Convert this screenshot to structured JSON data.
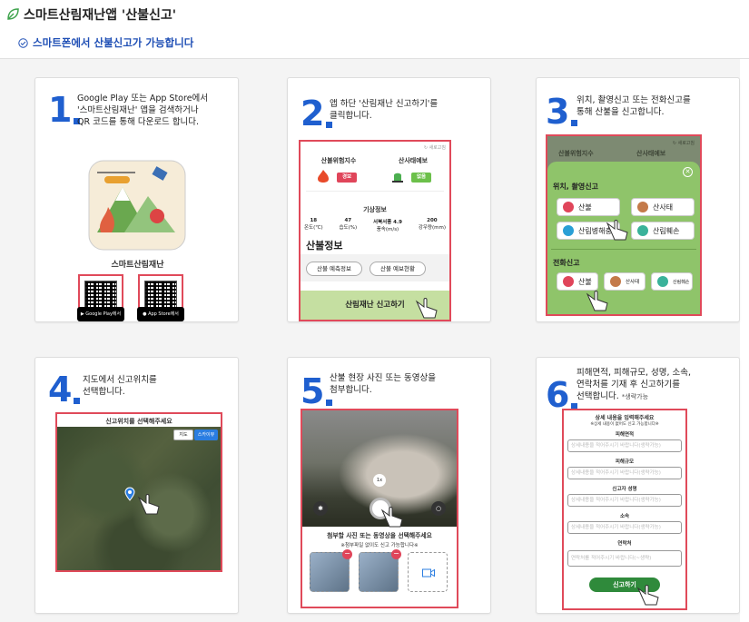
{
  "header": {
    "title": "스마트산림재난앱 '산불신고'",
    "subtitle": "스마트폰에서 산불신고가 가능합니다"
  },
  "colors": {
    "accent": "#1f5fcf",
    "highlight": "#e04a5a",
    "subtitle": "#1f4fb5",
    "panel": "#f4f4f4"
  },
  "steps": [
    {
      "num": "1",
      "lines": [
        "Google Play 또는 App Store에서",
        "'스마트산림재난' 앱을 검색하거나",
        "QR 코드를 통해 다운로드 합니다."
      ],
      "app_name": "스마트산림재난",
      "google_play": "Google Play에서",
      "app_store": "App Store에서"
    },
    {
      "num": "2",
      "lines": [
        "앱 하단 '산림재난 신고하기'를",
        "클릭합니다."
      ],
      "refresh": "새로고침",
      "fire_risk": "산불위험지수",
      "landslide": "산사태예보",
      "fire_level": "경보",
      "slide_level": "없음",
      "weather_title": "기상정보",
      "weather": [
        {
          "v": "18",
          "l": "온도(℃)"
        },
        {
          "v": "47",
          "l": "습도(%)"
        },
        {
          "v": "서북서풍 4.9",
          "l": "풍속(m/s)"
        },
        {
          "v": "200",
          "l": "강우량(mm)"
        }
      ],
      "info_title": "산불정보",
      "btn1": "산불 예측정보",
      "btn2": "산불 예보현황",
      "report_btn": "산림재난 신고하기"
    },
    {
      "num": "3",
      "lines": [
        "위치, 촬영신고 또는 전화신고를",
        "통해 산불을 신고합니다."
      ],
      "refresh": "새로고침",
      "bg1": "산불위험지수",
      "bg2": "산사태예보",
      "sec1": "위치, 촬영신고",
      "opt": [
        "산불",
        "산사태",
        "산림병해충",
        "산림훼손"
      ],
      "sec2": "전화신고",
      "call": [
        "산불",
        "산사태",
        "산림훼손"
      ]
    },
    {
      "num": "4",
      "lines": [
        "지도에서 신고위치를",
        "선택합니다."
      ],
      "map_title": "신고위치를 선택해주세요",
      "map_btn1": "지도",
      "map_btn2": "스카이뷰"
    },
    {
      "num": "5",
      "lines": [
        "산불 현장 사진 또는 동영상을",
        "첨부합니다."
      ],
      "zoom": "1x",
      "attach_title": "첨부할 사진 또는 동영상을 선택해주세요",
      "attach_note": "※첨부파일 없이도 신고 가능합니다※"
    },
    {
      "num": "6",
      "lines": [
        "피해면적, 피해규모, 성명, 소속,",
        "연락처를 기재 후 신고하기를",
        "선택합니다."
      ],
      "note": "*생략가능",
      "form_title": "상세 내용을 입력해주세요",
      "form_note": "※상세 내용이 없어도 신고 가능합니다※",
      "fields": [
        {
          "label": "피해면적",
          "ph": "상세내용을 적어주시기 바랍니다(생략가능)"
        },
        {
          "label": "피해규모",
          "ph": "상세내용을 적어주시기 바랍니다(생략가능)"
        },
        {
          "label": "신고자 성명",
          "ph": "상세내용을 적어주시기 바랍니다(생략가능)"
        },
        {
          "label": "소속",
          "ph": "상세내용을 적어주시기 바랍니다(생략가능)"
        },
        {
          "label": "연락처",
          "ph": "연락처를 적어주시기 바랍니다(~생략)"
        }
      ],
      "submit": "신고하기"
    }
  ]
}
